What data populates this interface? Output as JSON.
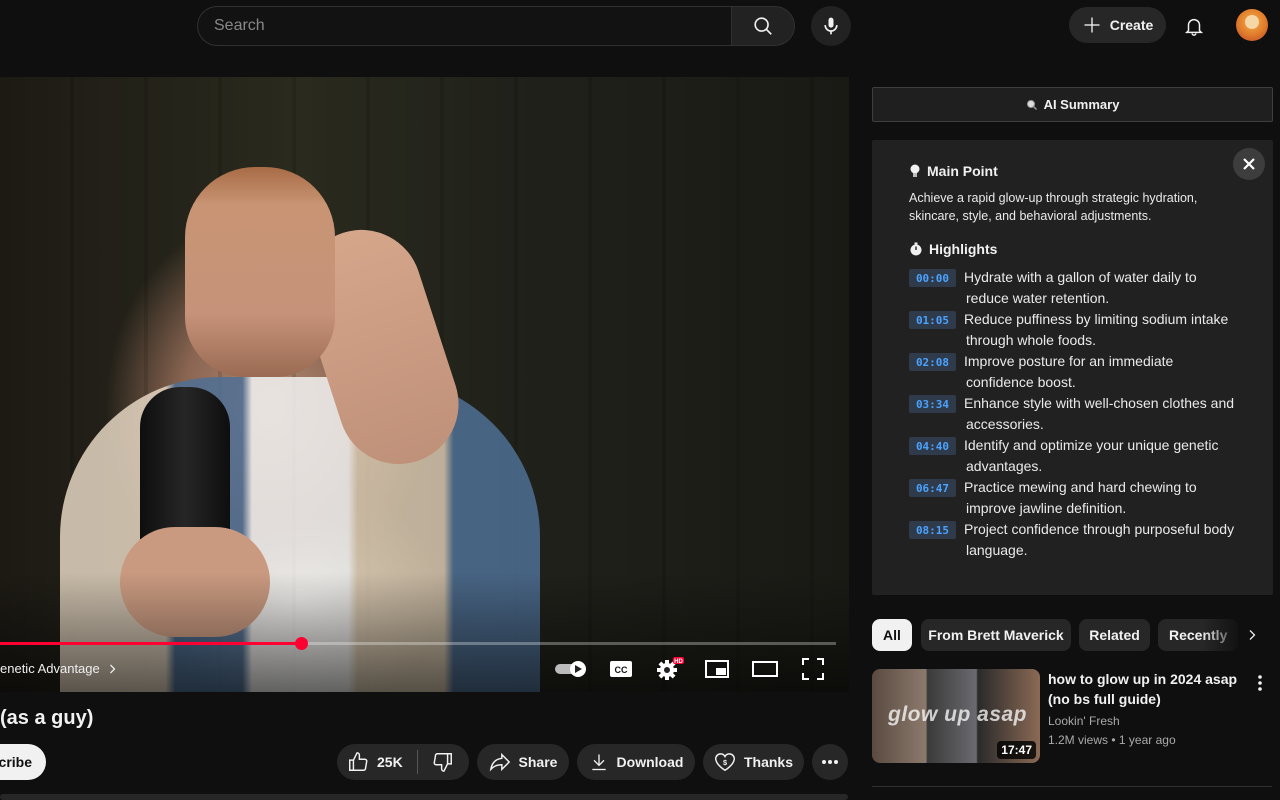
{
  "header": {
    "search_placeholder": "Search",
    "create_label": "Create",
    "icons": [
      "search-icon",
      "mic-icon",
      "plus-icon",
      "bell-icon",
      "avatar"
    ]
  },
  "player": {
    "progress_fraction": 0.36,
    "chapter_label": "enetic Advantage",
    "hd_badge": "HD",
    "cc_label": "CC"
  },
  "video": {
    "title": "(as a guy)",
    "subscribe_label": "cribe",
    "like_count": "25K",
    "share_label": "Share",
    "download_label": "Download",
    "thanks_label": "Thanks"
  },
  "summary": {
    "button_label": "AI Summary",
    "main_point_title": "Main Point",
    "main_point_line1": "Achieve a rapid glow-up through strategic hydration,",
    "main_point_line2": "skincare, style, and behavioral adjustments.",
    "highlights_title": "Highlights",
    "highlights": [
      {
        "time": "00:00",
        "line1": "Hydrate with a gallon of water daily to",
        "line2": "reduce water retention."
      },
      {
        "time": "01:05",
        "line1": "Reduce puffiness by limiting sodium intake",
        "line2": "through whole foods."
      },
      {
        "time": "02:08",
        "line1": "Improve posture for an immediate",
        "line2": "confidence boost."
      },
      {
        "time": "03:34",
        "line1": "Enhance style with well-chosen clothes and",
        "line2": "accessories."
      },
      {
        "time": "04:40",
        "line1": "Identify and optimize your unique genetic",
        "line2": "advantages."
      },
      {
        "time": "06:47",
        "line1": "Practice mewing and hard chewing to",
        "line2": "improve jawline definition."
      },
      {
        "time": "08:15",
        "line1": "Project confidence through purposeful body",
        "line2": "language."
      }
    ]
  },
  "chips": [
    "All",
    "From Brett Maverick",
    "Related",
    "Recently"
  ],
  "recommendation": {
    "thumb_text": "glow up asap",
    "duration": "17:47",
    "title_line1": "how to glow up in 2024 asap",
    "title_line2": "(no bs full guide)",
    "channel": "Lookin' Fresh",
    "views": "1.2M views",
    "age": "1 year ago"
  },
  "colors": {
    "background": "#0f0f0f",
    "accent_red": "#ff0033",
    "timestamp_blue": "#4aa3ff",
    "panel": "#212121"
  }
}
